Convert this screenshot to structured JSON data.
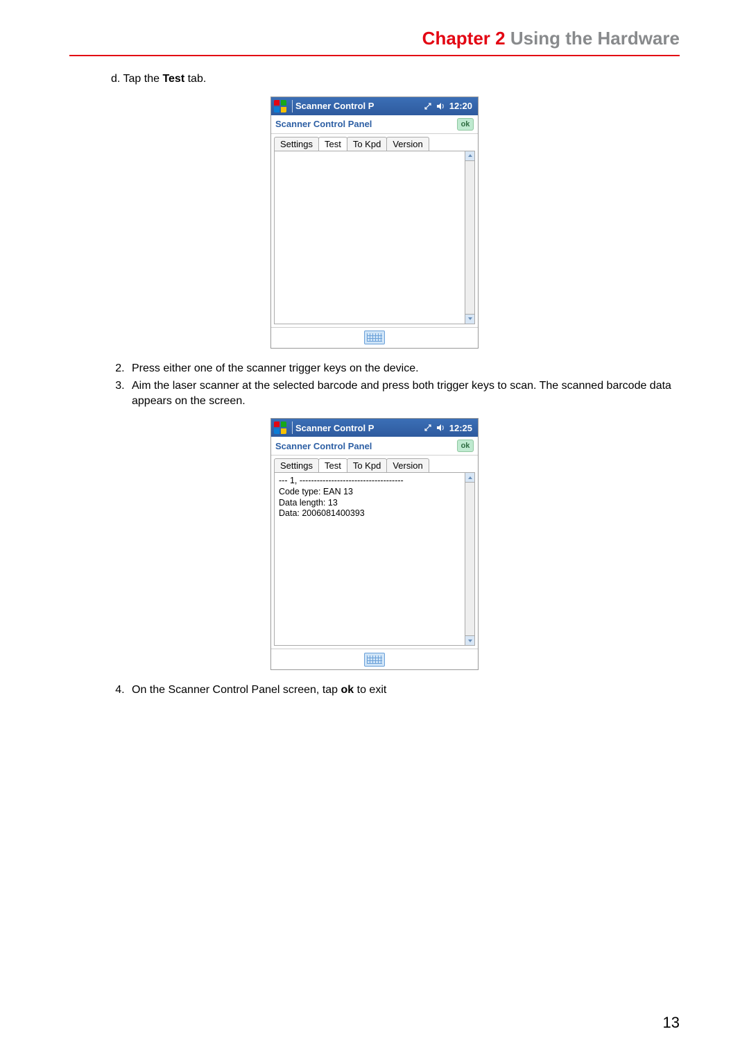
{
  "header": {
    "chapter_label": "Chapter 2",
    "chapter_title": "Using the Hardware"
  },
  "steps": {
    "d_prefix": "d.",
    "d_text_before_bold": "Tap the ",
    "d_bold": "Test",
    "d_text_after_bold": " tab.",
    "s2": "Press either one of the scanner trigger keys on the device.",
    "s3": "Aim the laser scanner at the selected barcode and press both trigger keys to scan. The scanned barcode data appears on the screen.",
    "s4_before_bold": "On the Scanner Control Panel screen, tap ",
    "s4_bold": "ok",
    "s4_after_bold": " to exit"
  },
  "screenshot1": {
    "topbar_title": "Scanner Control P",
    "time": "12:20",
    "subtitle": "Scanner Control Panel",
    "ok": "ok",
    "tabs": {
      "t1": "Settings",
      "t2": "Test",
      "t3": "To Kpd",
      "t4": "Version"
    },
    "content": ""
  },
  "screenshot2": {
    "topbar_title": "Scanner Control P",
    "time": "12:25",
    "subtitle": "Scanner Control Panel",
    "ok": "ok",
    "tabs": {
      "t1": "Settings",
      "t2": "Test",
      "t3": "To Kpd",
      "t4": "Version"
    },
    "content": "--- 1, ------------------------------------\nCode type: EAN 13\nData length: 13\nData: 2006081400393"
  },
  "page_number": "13"
}
